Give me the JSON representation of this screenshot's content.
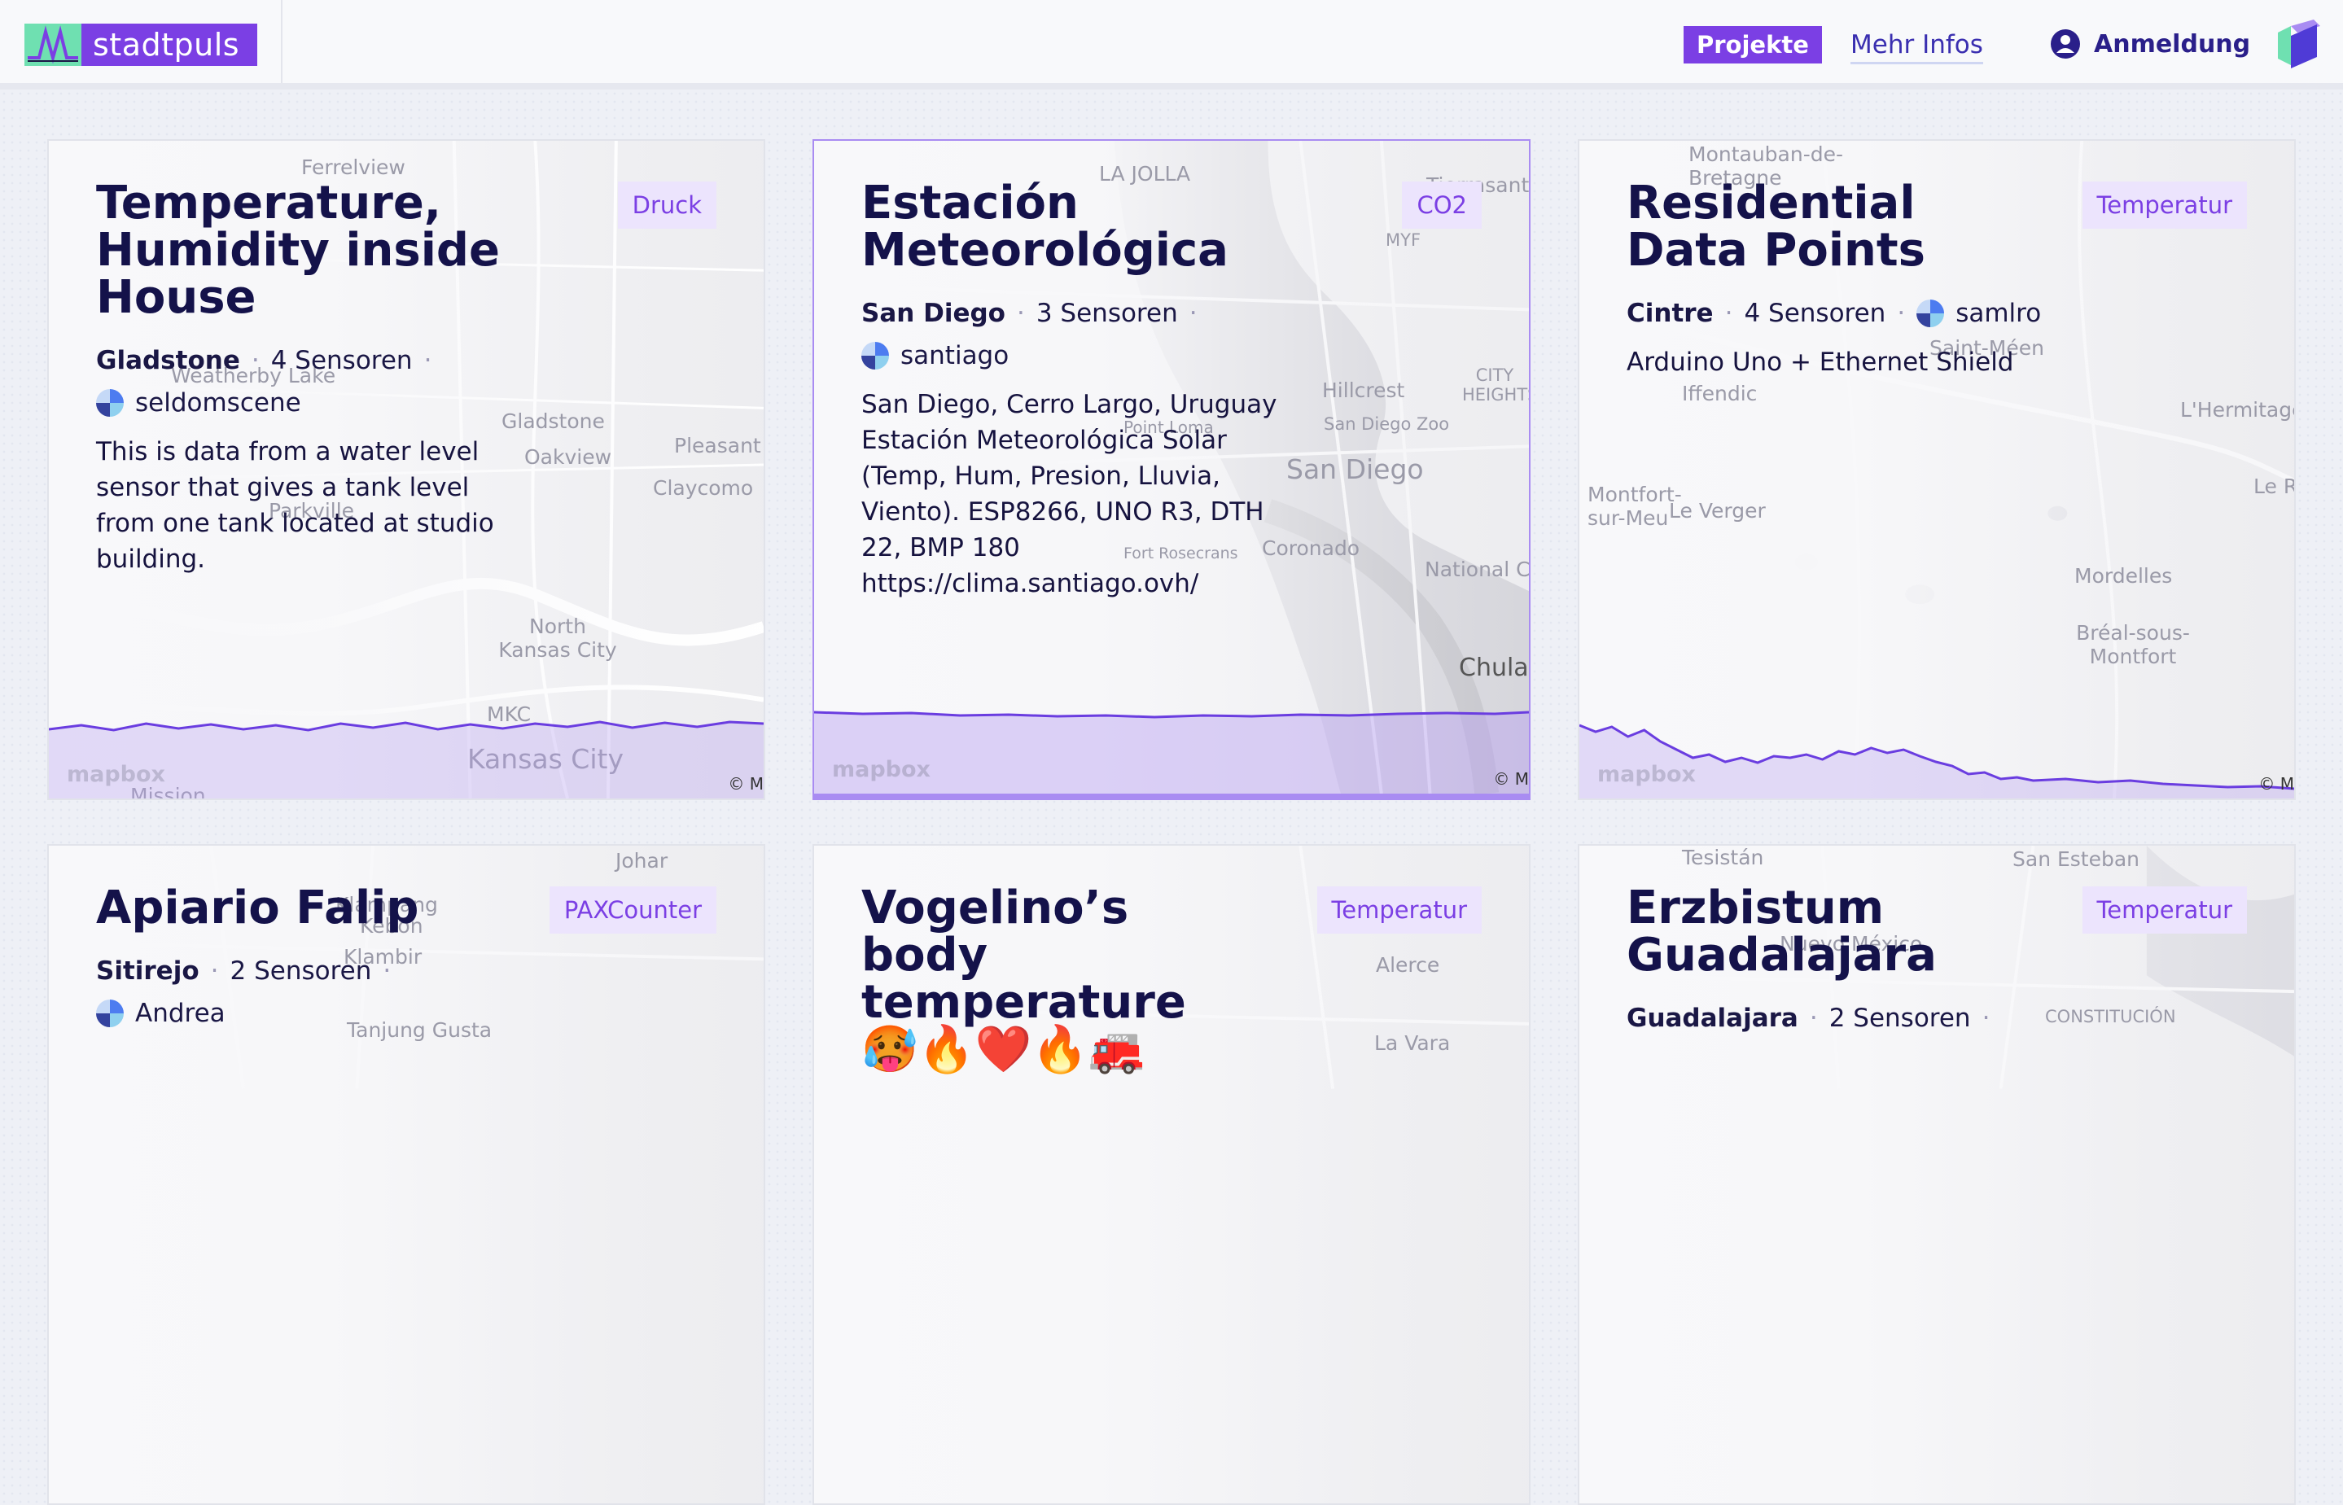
{
  "header": {
    "logo_text": "stadtpuls",
    "nav": {
      "projekte": "Projekte",
      "mehr_infos": "Mehr Infos",
      "anmeldung": "Anmeldung"
    }
  },
  "colors": {
    "accent": "#7b3fe4",
    "badge_bg": "#ece4fd",
    "text": "#14124a"
  },
  "cards": [
    {
      "title": "Temperature, Humidity inside House",
      "badge": "Druck",
      "location": "Gladstone",
      "sensors": "4 Sensoren",
      "user": "seldomscene",
      "description": "This is data from a water level sensor that gives a tank level from one tank located at studio building.",
      "map_labels": [
        "Ferrelview",
        "Weatherby Lake",
        "Parkville",
        "Gladstone",
        "Oakview",
        "Pleasant V",
        "Claycomo",
        "North Kansas City",
        "MKC",
        "Kansas City",
        "Mission"
      ],
      "mapbox": "mapbox",
      "copyright": "© M"
    },
    {
      "title": "Estación Meteorológica",
      "badge": "CO2",
      "location": "San Diego",
      "sensors": "3 Sensoren",
      "user": "santiago",
      "description": "San Diego, Cerro Largo, Uruguay Estación Meteorológica Solar (Temp, Hum, Presion, Lluvia, Viento). ESP8266, UNO R3, DTH 22, BMP 180 https://clima.santiago.ovh/",
      "map_labels": [
        "LA JOLLA",
        "Tierrasanta",
        "MYF",
        "Hillcrest",
        "CITY HEIGHTS",
        "San Diego Zoo",
        "San Diego",
        "Point Loma",
        "Coronado",
        "Fort Rosecrans",
        "National C",
        "Chula"
      ],
      "mapbox": "mapbox",
      "copyright": "© M"
    },
    {
      "title": "Residential Data Points",
      "badge": "Temperatur",
      "location": "Cintre",
      "sensors": "4 Sensoren",
      "user": "samlro",
      "description": "Arduino Uno + Ethernet Shield",
      "map_labels": [
        "Montauban-de-Bretagne",
        "Iffendic",
        "Mordelles",
        "L'Hermitage",
        "Le Rh",
        "Bréal-sous-Montfort",
        "Saint-Méen",
        "Le Verger",
        "Montfort-sur-Meu"
      ],
      "mapbox": "mapbox",
      "copyright": "© M"
    },
    {
      "title": "Apiario Falip",
      "badge": "PAXCounter",
      "location": "Sitirejo",
      "sensors": "2 Sensoren",
      "user": "Andrea",
      "description": "",
      "map_labels": [
        "Johar",
        "Klampang",
        "Kebon",
        "Klambir",
        "Tanjung Gusta"
      ]
    },
    {
      "title": "Vogelino’s body temperature 🥵🔥❤️🔥🚒",
      "badge": "Temperatur",
      "location": "",
      "sensors": "",
      "user": "",
      "description": "",
      "map_labels": [
        "Alerce",
        "La Vara"
      ]
    },
    {
      "title": "Erzbistum Guadalajara",
      "badge": "Temperatur",
      "location": "Guadalajara",
      "sensors": "2 Sensoren",
      "user": "",
      "description": "",
      "map_labels": [
        "Tesistán",
        "San Esteban",
        "Nuevo México",
        "CONSTITUCIÓN"
      ]
    }
  ]
}
